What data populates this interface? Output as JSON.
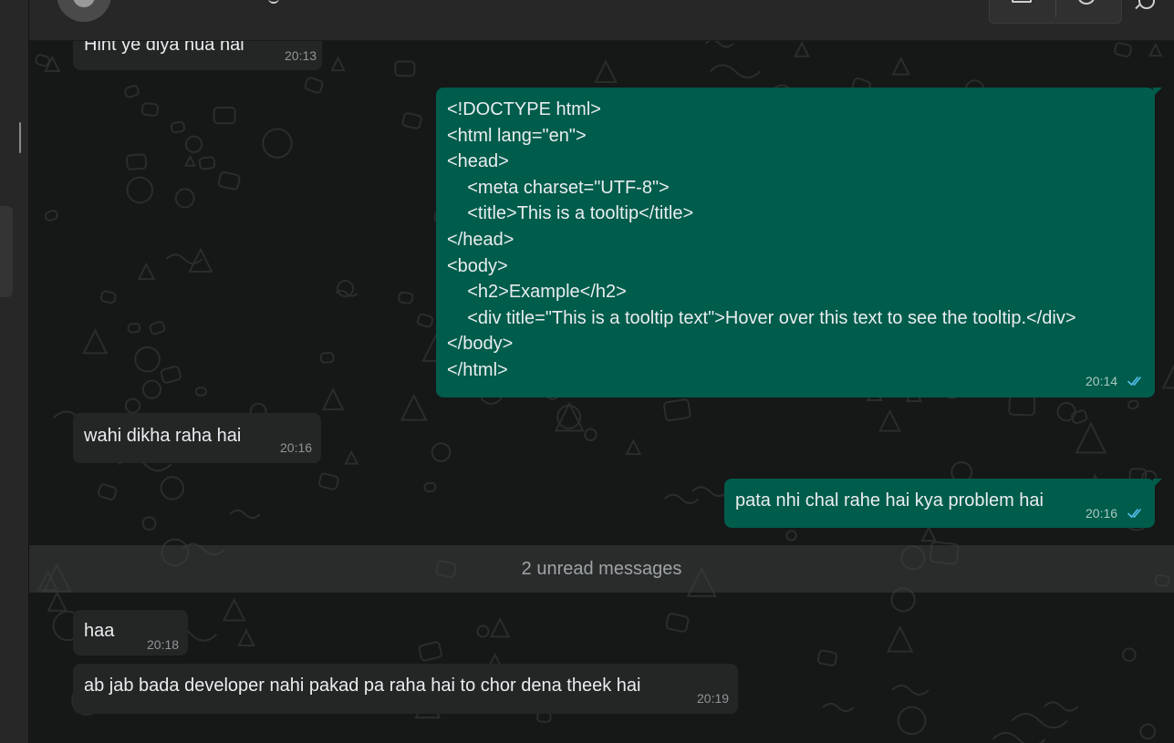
{
  "header": {
    "avatar_icon": "person-silhouette-icon",
    "call_icons": [
      "video-call-icon",
      "voice-call-icon"
    ],
    "search_icon": "search-icon"
  },
  "messages": [
    {
      "direction": "in",
      "text": "Hint ye diya hua hai",
      "time": "20:13"
    },
    {
      "direction": "out",
      "text": "<!DOCTYPE html>\n<html lang=\"en\">\n<head>\n    <meta charset=\"UTF-8\">\n    <title>This is a tooltip</title>\n</head>\n<body>\n    <h2>Example</h2>\n    <div title=\"This is a tooltip text\">Hover over this text to see the tooltip.</div>\n</body>\n</html>",
      "time": "20:14",
      "status": "read"
    },
    {
      "direction": "in",
      "text": "wahi dikha raha hai",
      "time": "20:16"
    },
    {
      "direction": "out",
      "text": "pata nhi chal rahe hai kya problem hai",
      "time": "20:16",
      "status": "read"
    },
    {
      "direction": "in",
      "text": "haa",
      "time": "20:18"
    },
    {
      "direction": "in",
      "text": "ab jab bada developer nahi pakad pa raha hai to chor dena theek hai",
      "time": "20:19"
    }
  ],
  "unread_divider": "2 unread messages",
  "colors": {
    "outgoing_bubble": "#005c4b",
    "incoming_bubble": "#242626",
    "read_check": "#53bdeb",
    "chat_background": "#161717"
  }
}
